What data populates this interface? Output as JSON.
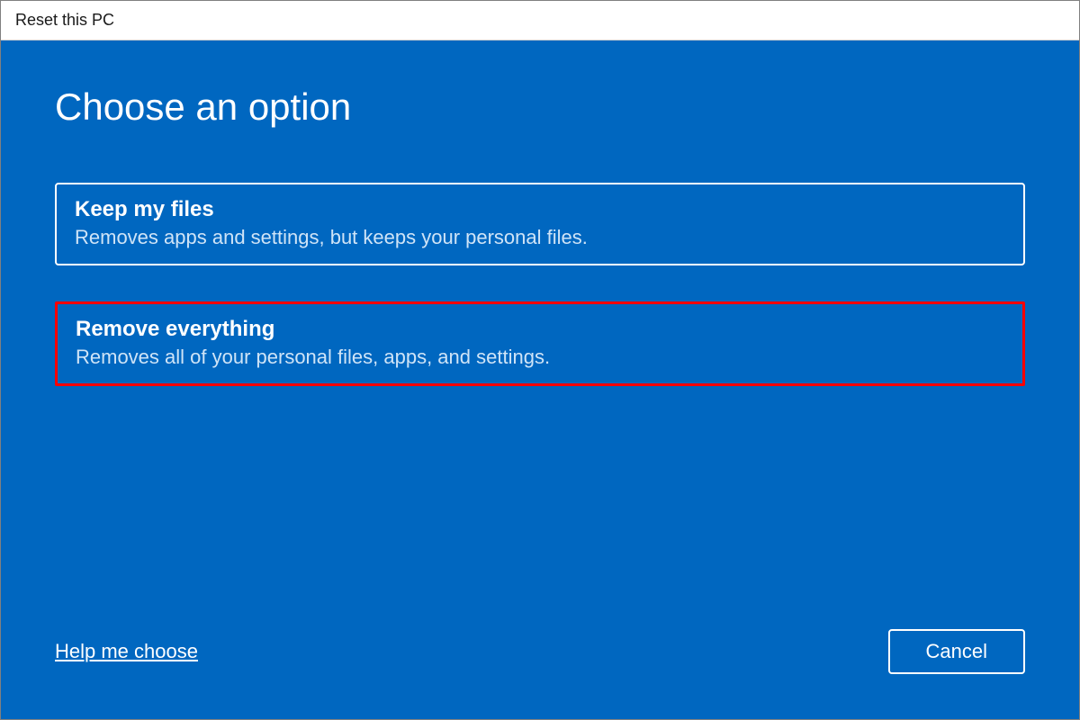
{
  "window": {
    "title": "Reset this PC"
  },
  "dialog": {
    "heading": "Choose an option",
    "options": [
      {
        "title": "Keep my files",
        "description": "Removes apps and settings, but keeps your personal files.",
        "highlighted": false
      },
      {
        "title": "Remove everything",
        "description": "Removes all of your personal files, apps, and settings.",
        "highlighted": true
      }
    ],
    "help_link": "Help me choose",
    "cancel_label": "Cancel"
  }
}
